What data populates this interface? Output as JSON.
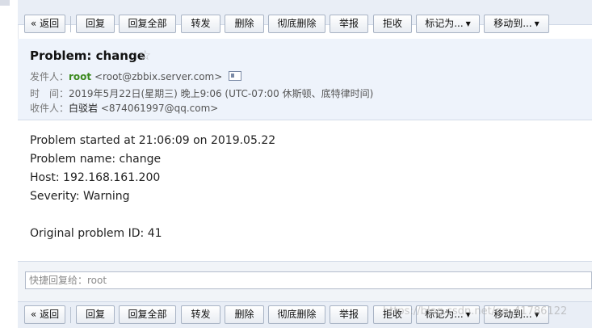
{
  "toolbar": {
    "back": "« 返回",
    "reply": "回复",
    "reply_all": "回复全部",
    "forward": "转发",
    "delete": "删除",
    "delete_permanent": "彻底删除",
    "report": "举报",
    "reject": "拒收",
    "mark_as": "标记为...",
    "move_to": "移动到..."
  },
  "email": {
    "subject": "Problem: change",
    "from_label": "发件人：",
    "from_name": "root",
    "from_address": "<root@zbbix.server.com>",
    "time_label": "时　间：",
    "time_value": "2019年5月22日(星期三) 晚上9:06 (UTC-07:00 休斯顿、底特律时间)",
    "to_label": "收件人：",
    "to_name": "白驳岩",
    "to_address": "<874061997@qq.com>"
  },
  "body": {
    "line1": "Problem started at 21:06:09 on 2019.05.22",
    "line2": "Problem name: change",
    "line3": "Host: 192.168.161.200",
    "line4": "Severity: Warning",
    "line5": "Original problem ID: 41"
  },
  "quick_reply": {
    "placeholder": "快捷回复给：root"
  },
  "watermark": "https://blog.csdn.net/qq_41786122"
}
